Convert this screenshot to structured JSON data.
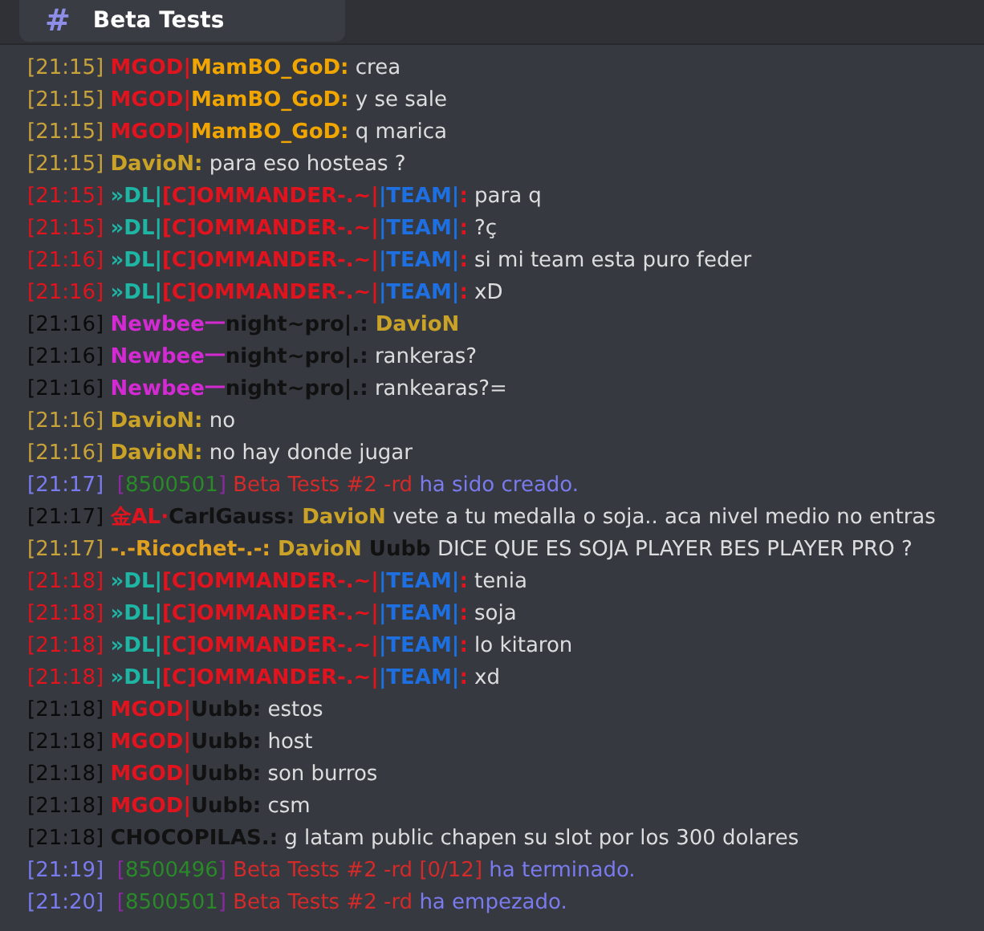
{
  "channel": {
    "icon": "#",
    "title": "Beta Tests"
  },
  "messages": [
    {
      "time": "[21:15]",
      "kind": "user",
      "parts": [
        {
          "kind": "name",
          "text": "MGOD|",
          "color": "#e0141e"
        },
        {
          "kind": "name",
          "text": "MamBO_GoD:",
          "color": "#f0a500"
        },
        {
          "kind": "text",
          "text": " crea",
          "color": "#dcddde"
        }
      ]
    },
    {
      "time": "[21:15]",
      "kind": "user",
      "parts": [
        {
          "kind": "name",
          "text": "MGOD|",
          "color": "#e0141e"
        },
        {
          "kind": "name",
          "text": "MamBO_GoD:",
          "color": "#f0a500"
        },
        {
          "kind": "text",
          "text": " y se sale",
          "color": "#dcddde"
        }
      ]
    },
    {
      "time": "[21:15]",
      "kind": "user",
      "parts": [
        {
          "kind": "name",
          "text": "MGOD|",
          "color": "#e0141e"
        },
        {
          "kind": "name",
          "text": "MamBO_GoD:",
          "color": "#f0a500"
        },
        {
          "kind": "text",
          "text": " q marica",
          "color": "#dcddde"
        }
      ]
    },
    {
      "time": "[21:15]",
      "kind": "user",
      "parts": [
        {
          "kind": "name",
          "text": "DavioN:",
          "color": "#c9a227"
        },
        {
          "kind": "text",
          "text": " para eso hosteas ?",
          "color": "#dcddde"
        }
      ]
    },
    {
      "time": "[21:15]",
      "kind": "team",
      "parts": [
        {
          "kind": "name",
          "text": "»DL|",
          "color": "#1fb5a5"
        },
        {
          "kind": "name",
          "text": "[C]OMMANDER-.~|",
          "color": "#e0141e"
        },
        {
          "kind": "name",
          "text": "|TEAM|",
          "color": "#1e6fe0"
        },
        {
          "kind": "name",
          "text": ":",
          "color": "#e0141e"
        },
        {
          "kind": "text",
          "text": " para q",
          "color": "#dcddde"
        }
      ]
    },
    {
      "time": "[21:15]",
      "kind": "team",
      "parts": [
        {
          "kind": "name",
          "text": "»DL|",
          "color": "#1fb5a5"
        },
        {
          "kind": "name",
          "text": "[C]OMMANDER-.~|",
          "color": "#e0141e"
        },
        {
          "kind": "name",
          "text": "|TEAM|",
          "color": "#1e6fe0"
        },
        {
          "kind": "name",
          "text": ":",
          "color": "#e0141e"
        },
        {
          "kind": "text",
          "text": " ?ç",
          "color": "#dcddde"
        }
      ]
    },
    {
      "time": "[21:16]",
      "kind": "team",
      "parts": [
        {
          "kind": "name",
          "text": "»DL|",
          "color": "#1fb5a5"
        },
        {
          "kind": "name",
          "text": "[C]OMMANDER-.~|",
          "color": "#e0141e"
        },
        {
          "kind": "name",
          "text": "|TEAM|",
          "color": "#1e6fe0"
        },
        {
          "kind": "name",
          "text": ":",
          "color": "#e0141e"
        },
        {
          "kind": "text",
          "text": " si mi team esta puro feder",
          "color": "#dcddde"
        }
      ]
    },
    {
      "time": "[21:16]",
      "kind": "team",
      "parts": [
        {
          "kind": "name",
          "text": "»DL|",
          "color": "#1fb5a5"
        },
        {
          "kind": "name",
          "text": "[C]OMMANDER-.~|",
          "color": "#e0141e"
        },
        {
          "kind": "name",
          "text": "|TEAM|",
          "color": "#1e6fe0"
        },
        {
          "kind": "name",
          "text": ":",
          "color": "#e0141e"
        },
        {
          "kind": "text",
          "text": " xD",
          "color": "#dcddde"
        }
      ]
    },
    {
      "time": "[21:16]",
      "kind": "guest",
      "parts": [
        {
          "kind": "name",
          "text": "Newbee一",
          "color": "#d42ad4"
        },
        {
          "kind": "name",
          "text": "night~pro|.:",
          "color": "#111111"
        },
        {
          "kind": "name",
          "text": " DavioN",
          "color": "#c9a227"
        }
      ]
    },
    {
      "time": "[21:16]",
      "kind": "guest",
      "parts": [
        {
          "kind": "name",
          "text": "Newbee一",
          "color": "#d42ad4"
        },
        {
          "kind": "name",
          "text": "night~pro|.:",
          "color": "#111111"
        },
        {
          "kind": "text",
          "text": " rankeras?",
          "color": "#dcddde"
        }
      ]
    },
    {
      "time": "[21:16]",
      "kind": "guest",
      "parts": [
        {
          "kind": "name",
          "text": "Newbee一",
          "color": "#d42ad4"
        },
        {
          "kind": "name",
          "text": "night~pro|.:",
          "color": "#111111"
        },
        {
          "kind": "text",
          "text": " rankearas?=",
          "color": "#dcddde"
        }
      ]
    },
    {
      "time": "[21:16]",
      "kind": "user",
      "parts": [
        {
          "kind": "name",
          "text": "DavioN:",
          "color": "#c9a227"
        },
        {
          "kind": "text",
          "text": " no",
          "color": "#dcddde"
        }
      ]
    },
    {
      "time": "[21:16]",
      "kind": "user",
      "parts": [
        {
          "kind": "name",
          "text": "DavioN:",
          "color": "#c9a227"
        },
        {
          "kind": "text",
          "text": " no hay donde jugar",
          "color": "#dcddde"
        }
      ]
    },
    {
      "time": "[21:17]",
      "kind": "system",
      "parts": [
        {
          "kind": "text",
          "text": " [",
          "color": "#8a2aa0"
        },
        {
          "kind": "text",
          "text": "8500501",
          "color": "#2a8a2a"
        },
        {
          "kind": "text",
          "text": "]",
          "color": "#8a2aa0"
        },
        {
          "kind": "text",
          "text": " Beta Tests #2 -rd",
          "color": "#d42a2a"
        },
        {
          "kind": "text",
          "text": " ha sido creado.",
          "color": "#7b7bf0"
        }
      ]
    },
    {
      "time": "[21:17]",
      "kind": "guest",
      "parts": [
        {
          "kind": "name",
          "text": "金AL·",
          "color": "#e0141e"
        },
        {
          "kind": "name",
          "text": "CarlGauss:",
          "color": "#111111"
        },
        {
          "kind": "name",
          "text": " DavioN",
          "color": "#c9a227"
        },
        {
          "kind": "text",
          "text": " vete a tu medalla o soja.. aca nivel medio no entras",
          "color": "#dcddde"
        }
      ]
    },
    {
      "time": "[21:17]",
      "kind": "user",
      "parts": [
        {
          "kind": "name",
          "text": "-.-Ricochet-.-:",
          "color": "#e0a020"
        },
        {
          "kind": "name",
          "text": " DavioN",
          "color": "#c9a227"
        },
        {
          "kind": "name",
          "text": " Uubb",
          "color": "#111111"
        },
        {
          "kind": "text",
          "text": " DICE QUE ES SOJA PLAYER BES PLAYER PRO ?",
          "color": "#dcddde"
        }
      ]
    },
    {
      "time": "[21:18]",
      "kind": "team",
      "parts": [
        {
          "kind": "name",
          "text": "»DL|",
          "color": "#1fb5a5"
        },
        {
          "kind": "name",
          "text": "[C]OMMANDER-.~|",
          "color": "#e0141e"
        },
        {
          "kind": "name",
          "text": "|TEAM|",
          "color": "#1e6fe0"
        },
        {
          "kind": "name",
          "text": ":",
          "color": "#e0141e"
        },
        {
          "kind": "text",
          "text": " tenia",
          "color": "#dcddde"
        }
      ]
    },
    {
      "time": "[21:18]",
      "kind": "team",
      "parts": [
        {
          "kind": "name",
          "text": "»DL|",
          "color": "#1fb5a5"
        },
        {
          "kind": "name",
          "text": "[C]OMMANDER-.~|",
          "color": "#e0141e"
        },
        {
          "kind": "name",
          "text": "|TEAM|",
          "color": "#1e6fe0"
        },
        {
          "kind": "name",
          "text": ":",
          "color": "#e0141e"
        },
        {
          "kind": "text",
          "text": " soja",
          "color": "#dcddde"
        }
      ]
    },
    {
      "time": "[21:18]",
      "kind": "team",
      "parts": [
        {
          "kind": "name",
          "text": "»DL|",
          "color": "#1fb5a5"
        },
        {
          "kind": "name",
          "text": "[C]OMMANDER-.~|",
          "color": "#e0141e"
        },
        {
          "kind": "name",
          "text": "|TEAM|",
          "color": "#1e6fe0"
        },
        {
          "kind": "name",
          "text": ":",
          "color": "#e0141e"
        },
        {
          "kind": "text",
          "text": " lo kitaron",
          "color": "#dcddde"
        }
      ]
    },
    {
      "time": "[21:18]",
      "kind": "team",
      "parts": [
        {
          "kind": "name",
          "text": "»DL|",
          "color": "#1fb5a5"
        },
        {
          "kind": "name",
          "text": "[C]OMMANDER-.~|",
          "color": "#e0141e"
        },
        {
          "kind": "name",
          "text": "|TEAM|",
          "color": "#1e6fe0"
        },
        {
          "kind": "name",
          "text": ":",
          "color": "#e0141e"
        },
        {
          "kind": "text",
          "text": " xd",
          "color": "#dcddde"
        }
      ]
    },
    {
      "time": "[21:18]",
      "kind": "guest",
      "parts": [
        {
          "kind": "name",
          "text": "MGOD|",
          "color": "#e0141e"
        },
        {
          "kind": "name",
          "text": "Uubb:",
          "color": "#111111"
        },
        {
          "kind": "text",
          "text": " estos",
          "color": "#dcddde"
        }
      ]
    },
    {
      "time": "[21:18]",
      "kind": "guest",
      "parts": [
        {
          "kind": "name",
          "text": "MGOD|",
          "color": "#e0141e"
        },
        {
          "kind": "name",
          "text": "Uubb:",
          "color": "#111111"
        },
        {
          "kind": "text",
          "text": " host",
          "color": "#dcddde"
        }
      ]
    },
    {
      "time": "[21:18]",
      "kind": "guest",
      "parts": [
        {
          "kind": "name",
          "text": "MGOD|",
          "color": "#e0141e"
        },
        {
          "kind": "name",
          "text": "Uubb:",
          "color": "#111111"
        },
        {
          "kind": "text",
          "text": " son burros",
          "color": "#dcddde"
        }
      ]
    },
    {
      "time": "[21:18]",
      "kind": "guest",
      "parts": [
        {
          "kind": "name",
          "text": "MGOD|",
          "color": "#e0141e"
        },
        {
          "kind": "name",
          "text": "Uubb:",
          "color": "#111111"
        },
        {
          "kind": "text",
          "text": " csm",
          "color": "#dcddde"
        }
      ]
    },
    {
      "time": "[21:18]",
      "kind": "guest",
      "parts": [
        {
          "kind": "name",
          "text": "CHOCOPILAS.:",
          "color": "#111111"
        },
        {
          "kind": "text",
          "text": " g latam public chapen su slot por los 300 dolares",
          "color": "#dcddde"
        }
      ]
    },
    {
      "time": "[21:19]",
      "kind": "system",
      "parts": [
        {
          "kind": "text",
          "text": " [",
          "color": "#8a2aa0"
        },
        {
          "kind": "text",
          "text": "8500496",
          "color": "#2a8a2a"
        },
        {
          "kind": "text",
          "text": "]",
          "color": "#8a2aa0"
        },
        {
          "kind": "text",
          "text": " Beta Tests #2 -rd [0/12]",
          "color": "#d42a2a"
        },
        {
          "kind": "text",
          "text": " ha terminado.",
          "color": "#7b7bf0"
        }
      ]
    },
    {
      "time": "[21:20]",
      "kind": "system",
      "parts": [
        {
          "kind": "text",
          "text": " [",
          "color": "#8a2aa0"
        },
        {
          "kind": "text",
          "text": "8500501",
          "color": "#2a8a2a"
        },
        {
          "kind": "text",
          "text": "]",
          "color": "#8a2aa0"
        },
        {
          "kind": "text",
          "text": " Beta Tests #2 -rd",
          "color": "#d42a2a"
        },
        {
          "kind": "text",
          "text": " ha empezado.",
          "color": "#7b7bf0"
        }
      ]
    }
  ]
}
